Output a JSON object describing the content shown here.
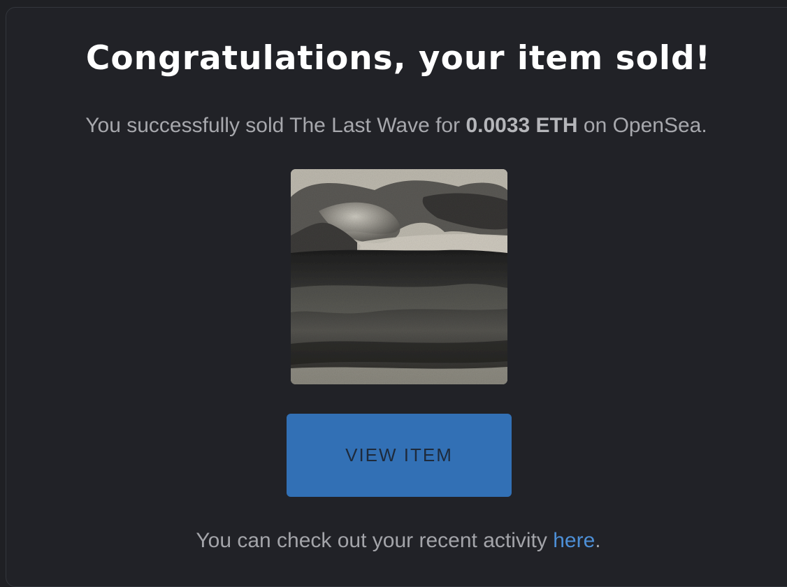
{
  "dialog": {
    "title": "Congratulations, your item sold!",
    "message": {
      "prefix": "You successfully sold The Last Wave for ",
      "price": "0.0033 ETH",
      "suffix": " on OpenSea."
    },
    "artwork_icon": "artwork-image",
    "view_button_label": "VIEW ITEM",
    "footer": {
      "prefix": "You can check out your recent activity ",
      "link_label": "here",
      "suffix": "."
    }
  },
  "colors": {
    "background": "#212227",
    "button": "#3270b5",
    "link": "#4d8fd6",
    "title": "#ffffff",
    "muted_text": "#a7a8ad"
  }
}
